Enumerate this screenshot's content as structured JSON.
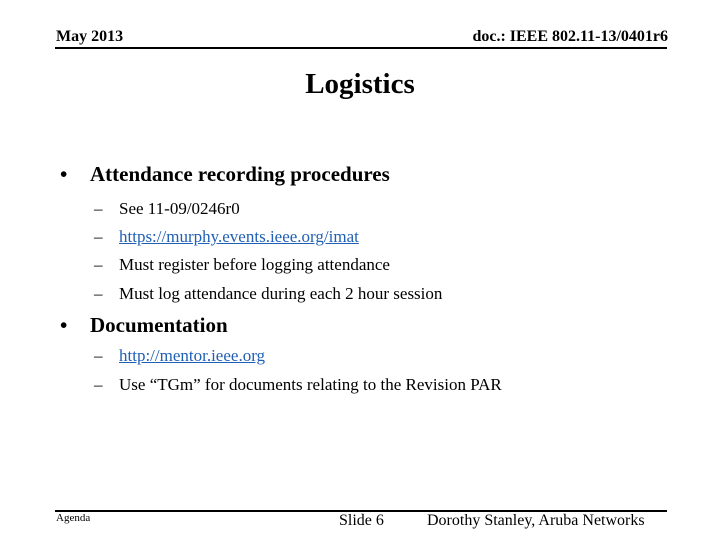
{
  "header": {
    "date": "May 2013",
    "doc_id": "doc.: IEEE 802.11-13/0401r6"
  },
  "title": "Logistics",
  "sections": [
    {
      "bullet": "•",
      "heading": "Attendance recording procedures",
      "items": [
        {
          "dash": "–",
          "text": "See 11-09/0246r0",
          "is_link": false
        },
        {
          "dash": "–",
          "text": "https://murphy.events.ieee.org/imat",
          "is_link": true
        },
        {
          "dash": "–",
          "text": "Must register before logging attendance",
          "is_link": false
        },
        {
          "dash": "–",
          "text": "Must log attendance during each 2 hour session",
          "is_link": false
        }
      ]
    },
    {
      "bullet": "•",
      "heading": "Documentation",
      "items": [
        {
          "dash": "–",
          "text": "http://mentor.ieee.org",
          "is_link": true
        },
        {
          "dash": "–",
          "text": "Use “TGm” for documents relating to the Revision PAR",
          "is_link": false
        }
      ]
    }
  ],
  "footer": {
    "left": "Agenda",
    "slide": "Slide 6",
    "author": "Dorothy Stanley, Aruba Networks"
  },
  "colors": {
    "link": "#1f5fb5"
  }
}
